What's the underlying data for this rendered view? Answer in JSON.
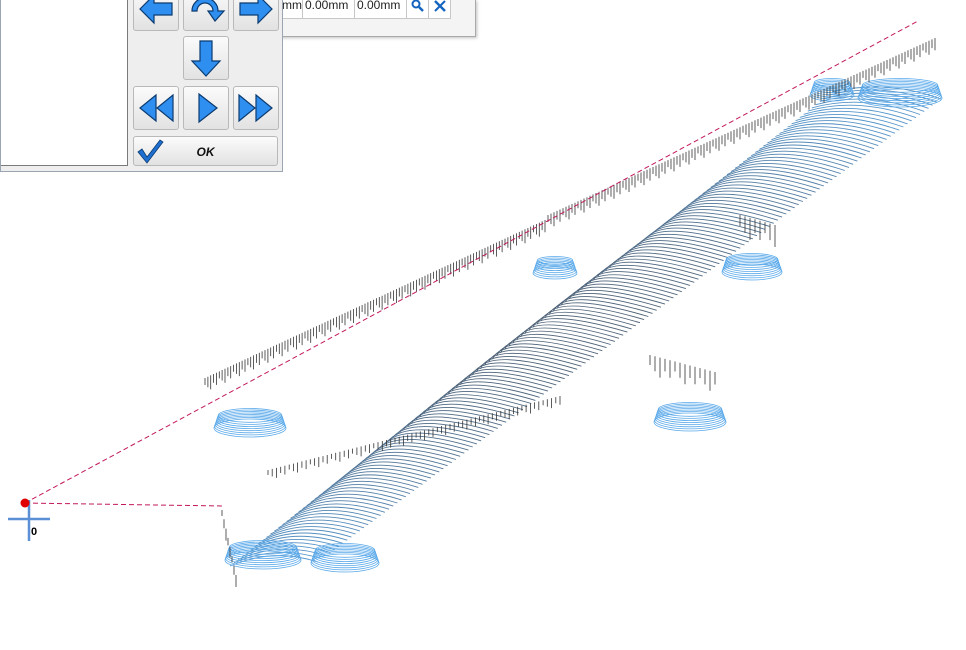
{
  "table": {
    "cells": [
      "mm",
      "0.00mm",
      "0.00mm"
    ],
    "icons": [
      "magnifier-icon",
      "tools-icon"
    ]
  },
  "control_panel": {
    "buttons": [
      {
        "name": "move-left-button",
        "icon": "arrow-left-icon"
      },
      {
        "name": "rotate-button",
        "icon": "rotate-icon"
      },
      {
        "name": "move-right-button",
        "icon": "arrow-right-icon"
      },
      {
        "name": "move-down-button",
        "icon": "arrow-down-icon"
      },
      {
        "name": "rewind-button",
        "icon": "rewind-icon"
      },
      {
        "name": "play-button",
        "icon": "play-icon"
      },
      {
        "name": "fast-forward-button",
        "icon": "fast-forward-icon"
      }
    ],
    "ok_label": "OK",
    "ok_icon": "checkmark-icon"
  },
  "viewport": {
    "origin_label": "0",
    "colors": {
      "model_light": "#5aa9ea",
      "model_dark": "#4c5563",
      "toolpath_dash": "#c2185b",
      "origin_marker": "#e00000",
      "axis_cross": "#5b8fd6",
      "button_blue": "#2f8ff0"
    }
  }
}
